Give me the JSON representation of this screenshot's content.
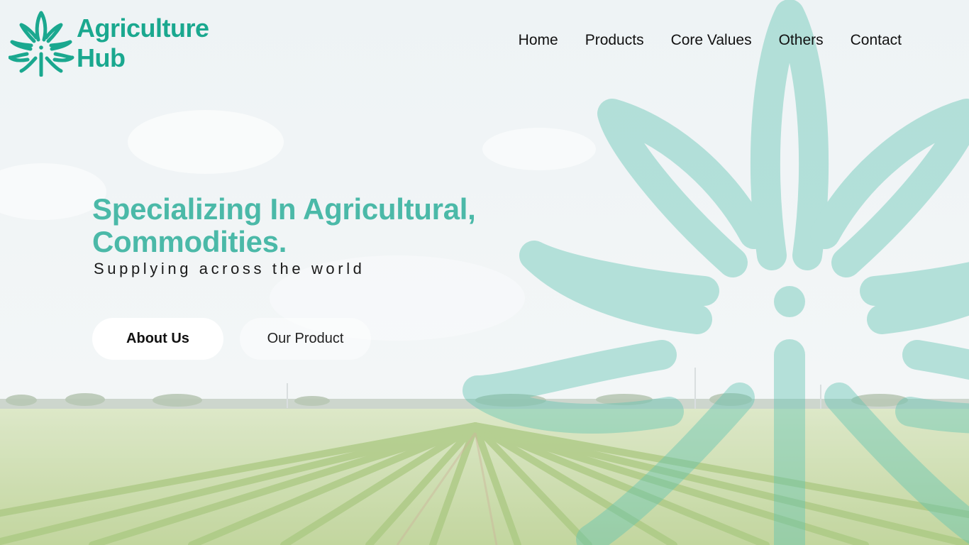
{
  "brand": {
    "line1": "Agriculture",
    "line2": "Hub",
    "color": "#1aa88f"
  },
  "nav": {
    "items": [
      {
        "label": "Home"
      },
      {
        "label": "Products"
      },
      {
        "label": "Core Values"
      },
      {
        "label": "Others"
      },
      {
        "label": "Contact"
      }
    ]
  },
  "hero": {
    "title": "Specializing In Agricultural, Commodities.",
    "subtitle": "Supplying across the world",
    "title_color": "#4bb9a8"
  },
  "buttons": {
    "primary_label": "About Us",
    "secondary_label": "Our Product"
  },
  "icons": {
    "logo": "leaf-star-icon",
    "background_mark": "leaf-star-icon"
  }
}
